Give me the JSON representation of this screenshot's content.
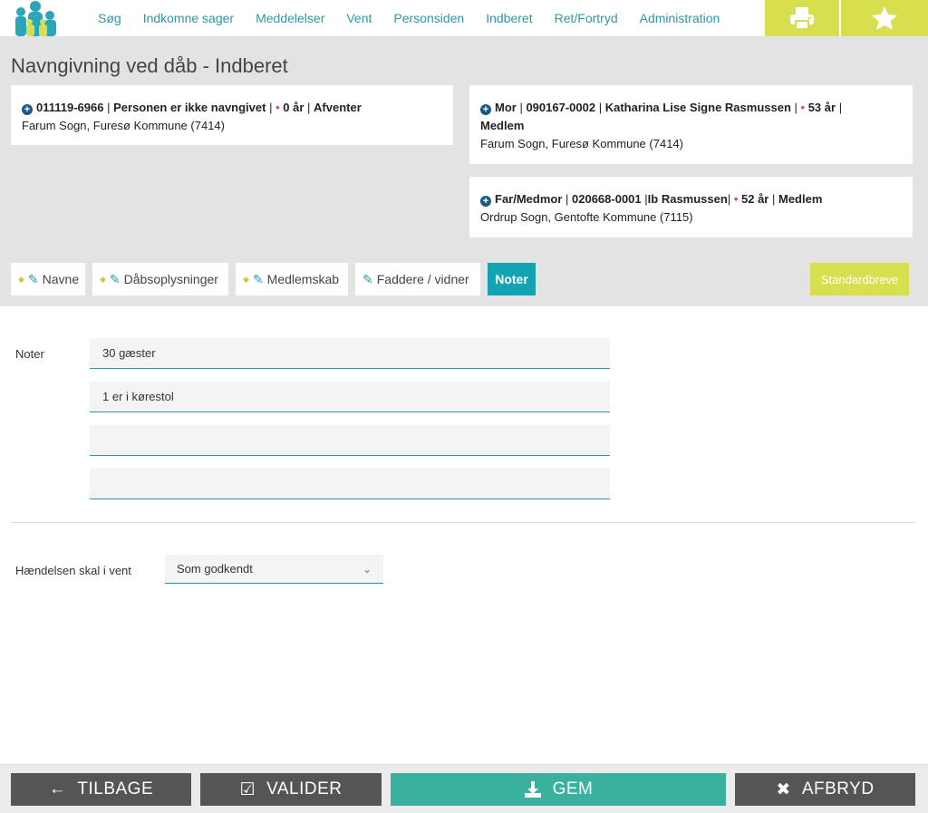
{
  "nav": {
    "items": [
      "Søg",
      "Indkomne sager",
      "Meddelelser",
      "Vent",
      "Personsiden",
      "Indberet",
      "Ret/Fortryd",
      "Administration"
    ],
    "print_icon": "printer-icon",
    "star_icon": "star-icon"
  },
  "page": {
    "title": "Navngivning ved dåb - Indberet"
  },
  "child": {
    "id": "011119-6966",
    "name": "Personen er ikke navngivet",
    "age": "0 år",
    "status": "Afventer",
    "parish": "Farum Sogn, Furesø Kommune (7414)"
  },
  "mother": {
    "role": "Mor",
    "id": "090167-0002",
    "name": "Katharina Lise Signe Rasmussen",
    "age": "53 år",
    "status": "Medlem",
    "parish": "Farum Sogn, Furesø Kommune (7414)"
  },
  "father": {
    "role": "Far/Medmor",
    "id": "020668-0001",
    "name": "Ib Rasmussen",
    "age": "52 år",
    "status": "Medlem",
    "parish": "Ordrup Sogn, Gentofte Kommune (7115)"
  },
  "tabs": {
    "navne": "Navne",
    "daab": "Dåbsoplysninger",
    "medlem": "Medlemskab",
    "faddere": "Faddere / vidner",
    "noter": "Noter"
  },
  "standard_letters": "Standardbreve",
  "notes": {
    "label": "Noter",
    "lines": [
      "30 gæster",
      "1 er i kørestol",
      "",
      ""
    ]
  },
  "hold": {
    "label": "Hændelsen skal i vent",
    "selected": "Som godkendt"
  },
  "footer": {
    "back": "TILBAGE",
    "validate": "VALIDER",
    "save": "GEM",
    "cancel": "AFBRYD"
  },
  "colors": {
    "accent": "#2a9aa8",
    "active_tab": "#13a3b3",
    "lime": "#d7df4f",
    "save": "#3ab09e",
    "dark_button": "#555555"
  }
}
